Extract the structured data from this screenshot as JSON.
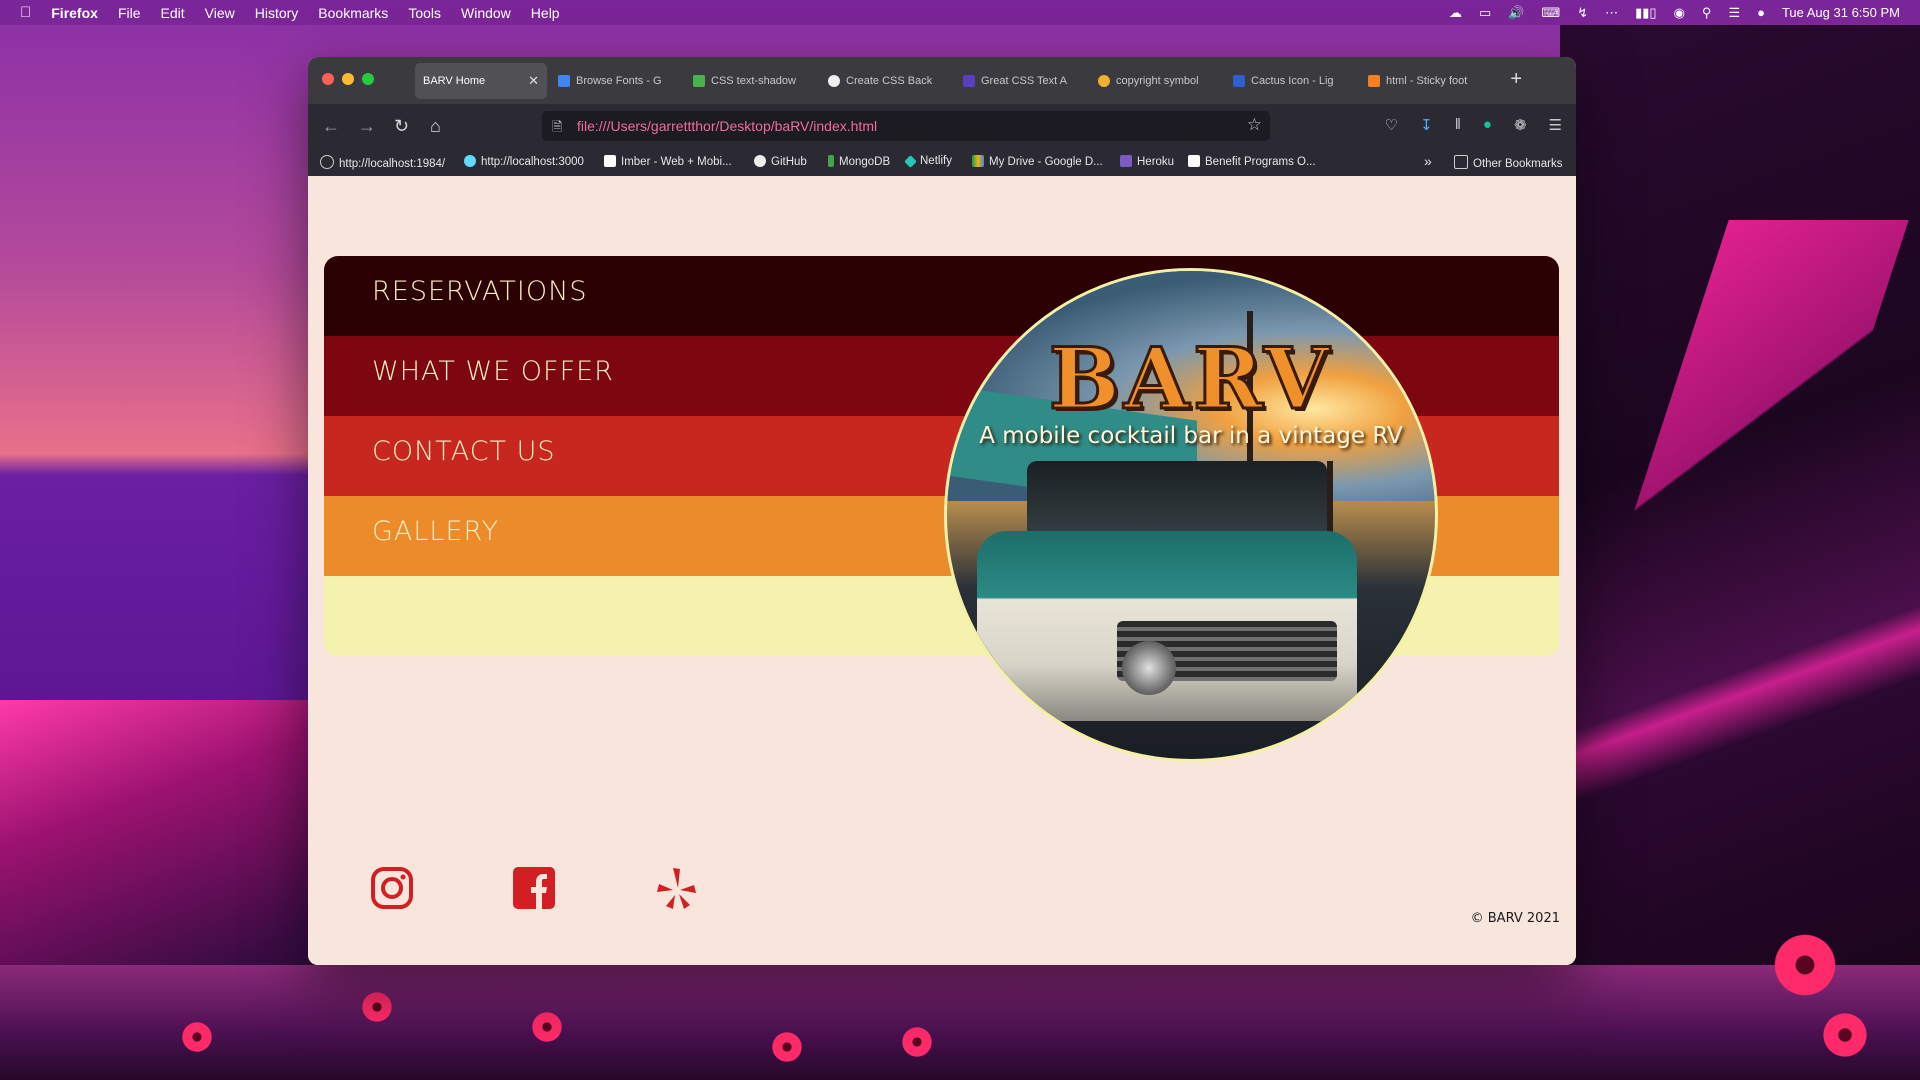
{
  "menubar": {
    "app": "Firefox",
    "items": [
      "File",
      "Edit",
      "View",
      "History",
      "Bookmarks",
      "Tools",
      "Window",
      "Help"
    ],
    "clock": "Tue Aug 31  6:50 PM"
  },
  "browser": {
    "tabs": [
      {
        "label": "BARV Home",
        "active": true
      },
      {
        "label": "Browse Fonts - G"
      },
      {
        "label": "CSS text-shadow"
      },
      {
        "label": "Create CSS Back"
      },
      {
        "label": "Great CSS Text A"
      },
      {
        "label": "copyright symbol"
      },
      {
        "label": "Cactus Icon - Lig"
      },
      {
        "label": "html - Sticky foot"
      }
    ],
    "url": "file:///Users/garrettthor/Desktop/baRV/index.html",
    "bookmarks": [
      "http://localhost:1984/",
      "http://localhost:3000",
      "Imber - Web + Mobi...",
      "GitHub",
      "MongoDB",
      "Netlify",
      "My Drive - Google D...",
      "Heroku",
      "Benefit Programs O..."
    ],
    "other_bookmarks": "Other Bookmarks"
  },
  "page": {
    "nav": [
      "RESERVATIONS",
      "WHAT WE OFFER",
      "CONTACT US",
      "GALLERY"
    ],
    "brand": "BARV",
    "tagline": "A mobile cocktail bar in a vintage RV",
    "copyright": "© BARV 2021",
    "colors": {
      "stripe1": "#2c0104",
      "stripe2": "#7d0711",
      "stripe3": "#c8271f",
      "stripe4": "#ec8b2a",
      "stripe5": "#f5f2ae",
      "social": "#d11f24"
    },
    "social_icons": [
      "instagram-icon",
      "facebook-icon",
      "yelp-icon"
    ]
  }
}
